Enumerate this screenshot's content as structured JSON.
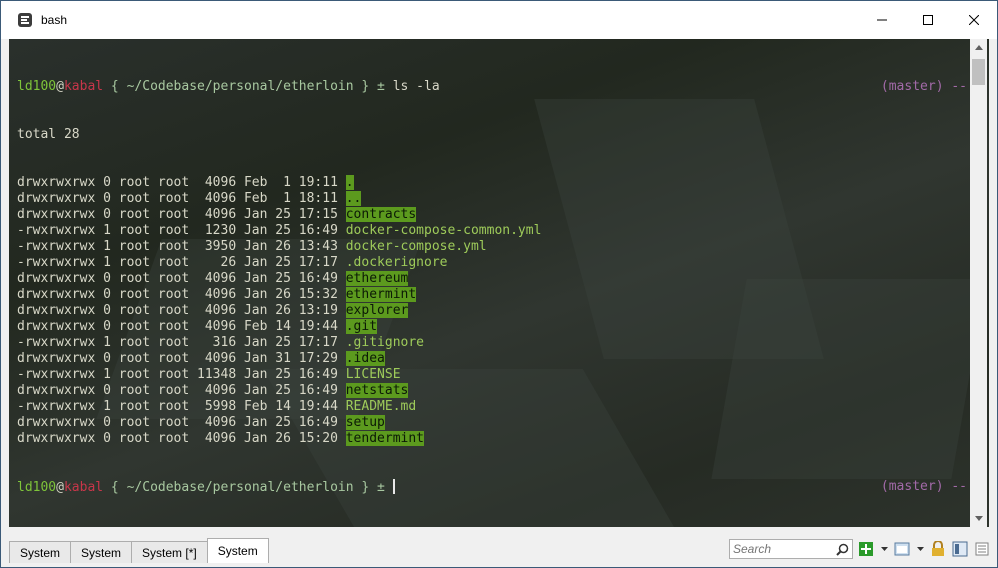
{
  "window": {
    "title": "bash"
  },
  "terminal": {
    "prompt": {
      "user": "ld100",
      "at": "@",
      "host": "kabal",
      "path": " { ~/Codebase/personal/etherloin } ± ",
      "branch": "(master) --"
    },
    "command": "ls -la",
    "total": "total 28",
    "entries": [
      {
        "meta": "drwxrwxrwx 0 root root  4096 Feb  1 19:11 ",
        "name": ".",
        "style": "hl"
      },
      {
        "meta": "drwxrwxrwx 0 root root  4096 Feb  1 18:11 ",
        "name": "..",
        "style": "hl"
      },
      {
        "meta": "drwxrwxrwx 0 root root  4096 Jan 25 17:15 ",
        "name": "contracts",
        "style": "hl"
      },
      {
        "meta": "-rwxrwxrwx 1 root root  1230 Jan 25 16:49 ",
        "name": "docker-compose-common.yml",
        "style": "file"
      },
      {
        "meta": "-rwxrwxrwx 1 root root  3950 Jan 26 13:43 ",
        "name": "docker-compose.yml",
        "style": "file"
      },
      {
        "meta": "-rwxrwxrwx 1 root root    26 Jan 25 17:17 ",
        "name": ".dockerignore",
        "style": "file"
      },
      {
        "meta": "drwxrwxrwx 0 root root  4096 Jan 25 16:49 ",
        "name": "ethereum",
        "style": "hl"
      },
      {
        "meta": "drwxrwxrwx 0 root root  4096 Jan 26 15:32 ",
        "name": "ethermint",
        "style": "hl"
      },
      {
        "meta": "drwxrwxrwx 0 root root  4096 Jan 26 13:19 ",
        "name": "explorer",
        "style": "hl"
      },
      {
        "meta": "drwxrwxrwx 0 root root  4096 Feb 14 19:44 ",
        "name": ".git",
        "style": "hl"
      },
      {
        "meta": "-rwxrwxrwx 1 root root   316 Jan 25 17:17 ",
        "name": ".gitignore",
        "style": "file"
      },
      {
        "meta": "drwxrwxrwx 0 root root  4096 Jan 31 17:29 ",
        "name": ".idea",
        "style": "hl"
      },
      {
        "meta": "-rwxrwxrwx 1 root root 11348 Jan 25 16:49 ",
        "name": "LICENSE",
        "style": "file"
      },
      {
        "meta": "drwxrwxrwx 0 root root  4096 Jan 25 16:49 ",
        "name": "netstats",
        "style": "hl"
      },
      {
        "meta": "-rwxrwxrwx 1 root root  5998 Feb 14 19:44 ",
        "name": "README.md",
        "style": "file"
      },
      {
        "meta": "drwxrwxrwx 0 root root  4096 Jan 25 16:49 ",
        "name": "setup",
        "style": "hl"
      },
      {
        "meta": "drwxrwxrwx 0 root root  4096 Jan 26 15:20 ",
        "name": "tendermint",
        "style": "hl"
      }
    ]
  },
  "tabs": [
    {
      "label": "System",
      "active": false
    },
    {
      "label": "System",
      "active": false
    },
    {
      "label": "System [*]",
      "active": false
    },
    {
      "label": "System",
      "active": true
    }
  ],
  "search": {
    "placeholder": "Search"
  },
  "colors": {
    "user": "#7ec43a",
    "host": "#c8364a",
    "branch": "#a26aa8",
    "dir_highlight": "#5c9a1e"
  },
  "icons": {
    "app": "console-icon",
    "minimize": "minimize-icon",
    "maximize": "maximize-icon",
    "close": "close-icon",
    "search": "search-icon",
    "new_console": "plus-icon",
    "lock": "lock-icon"
  }
}
